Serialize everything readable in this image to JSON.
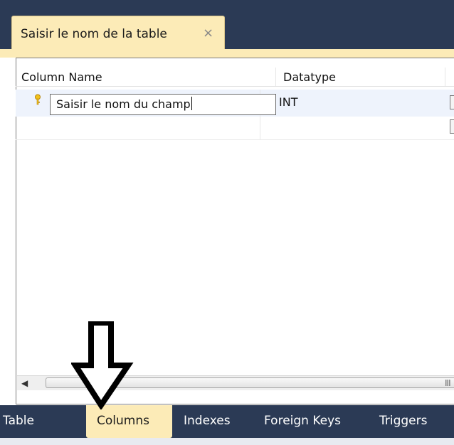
{
  "document_tab": {
    "title": "Saisir le nom de la table",
    "close_glyph": "×"
  },
  "grid": {
    "headers": {
      "column_name": "Column Name",
      "datatype": "Datatype"
    },
    "rows": [
      {
        "primary_key_icon": "key-icon",
        "name": "Saisir le nom du champ",
        "datatype": "INT"
      }
    ]
  },
  "scrollbar": {
    "left_glyph": "◀",
    "grip_glyph": "III"
  },
  "bottom_tabs": [
    {
      "label": "Table",
      "active": false
    },
    {
      "label": "Columns",
      "active": true
    },
    {
      "label": "Indexes",
      "active": false
    },
    {
      "label": "Foreign Keys",
      "active": false
    },
    {
      "label": "Triggers",
      "active": false
    }
  ],
  "colors": {
    "title_bar": "#2b3a55",
    "active_tab": "#fcebb7",
    "selected_row": "#eef3fc"
  },
  "annotation": {
    "type": "down-arrow",
    "points_to": "Columns"
  }
}
